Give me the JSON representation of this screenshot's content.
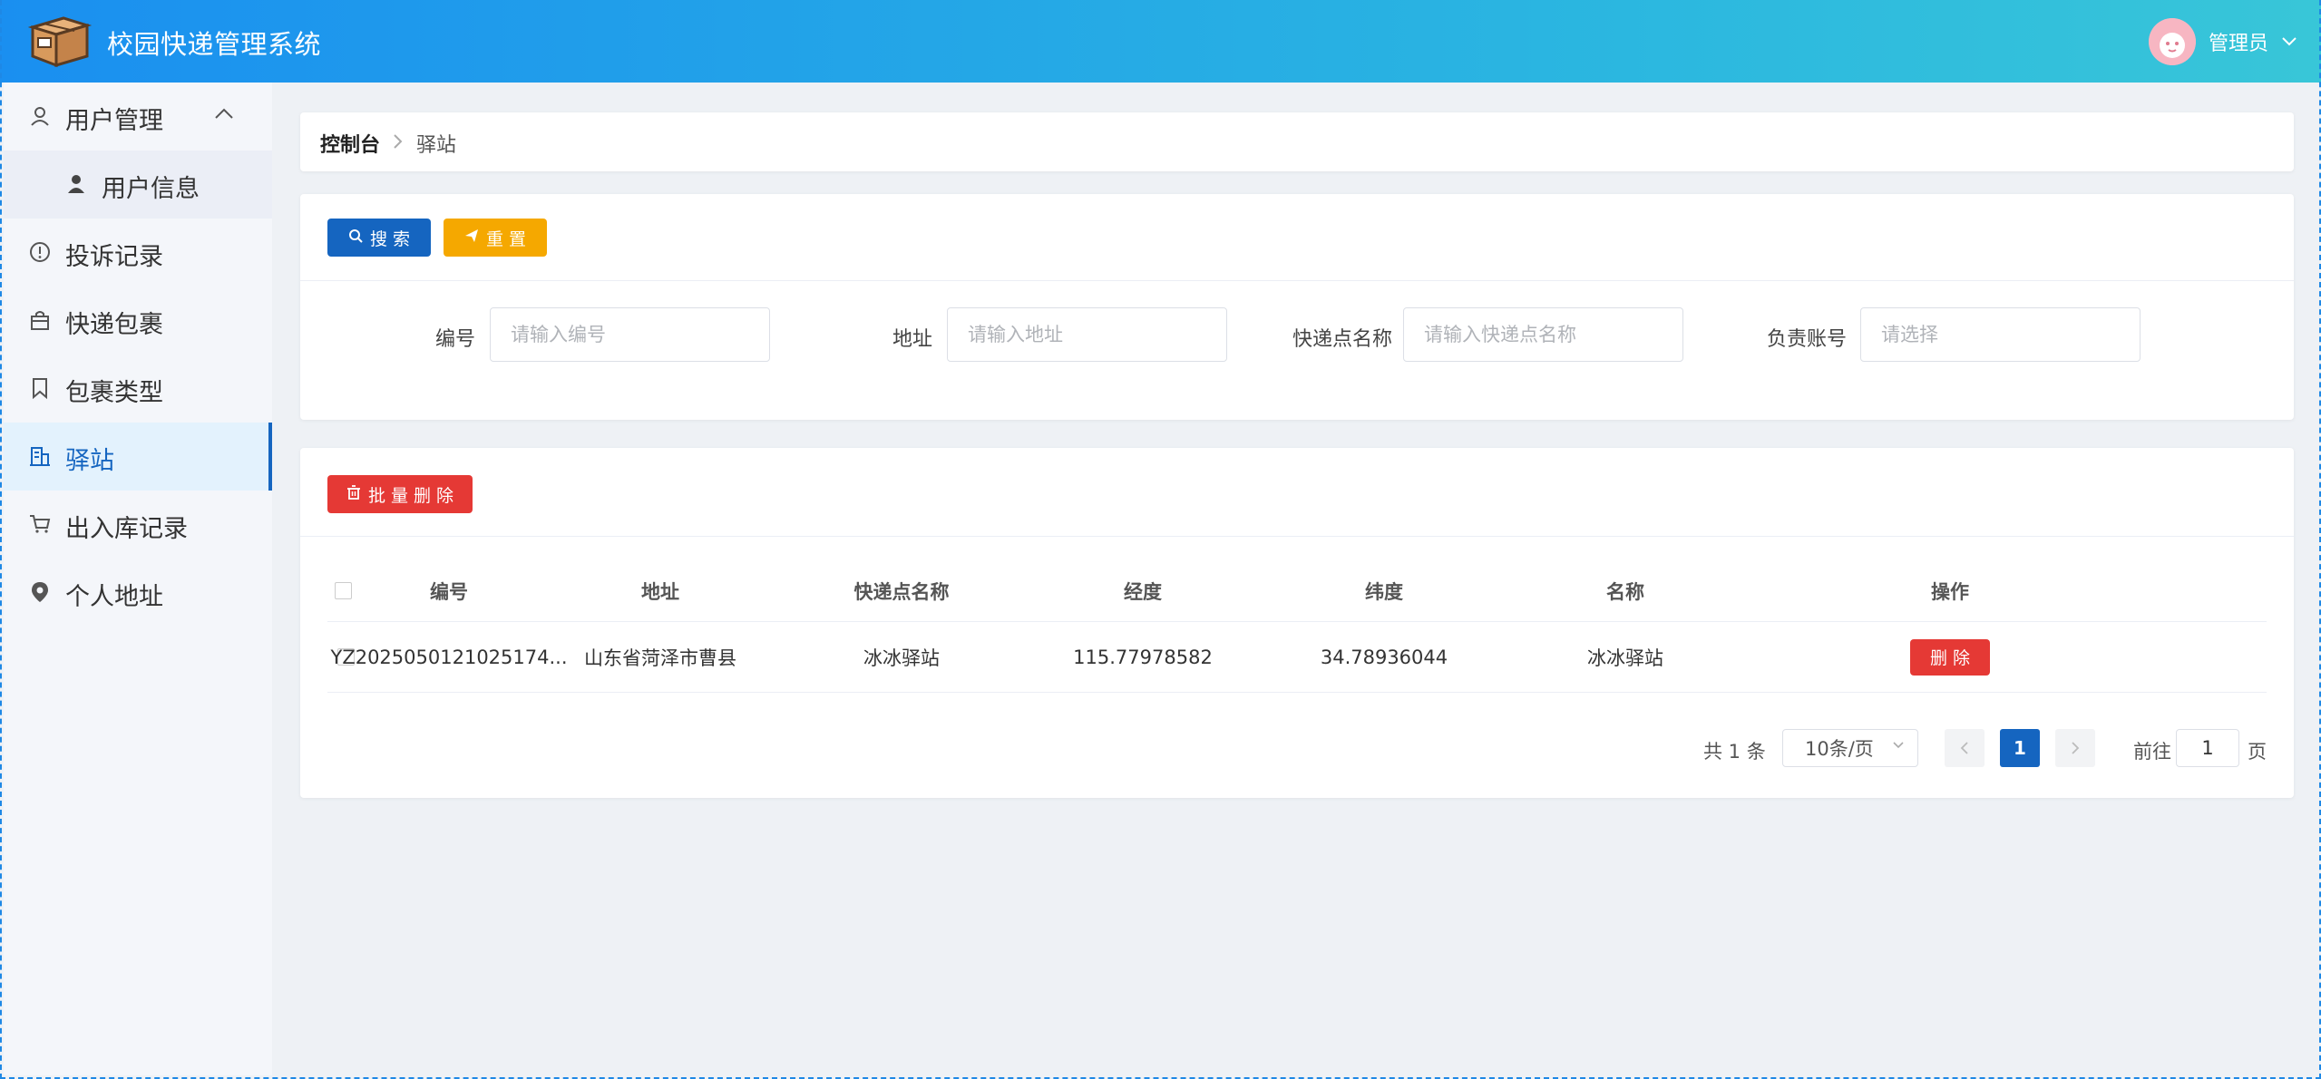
{
  "header": {
    "app_title": "校园快递管理系统",
    "user_name": "管理员"
  },
  "sidebar": {
    "items": [
      {
        "label": "用户管理",
        "icon": "user-outline-icon",
        "expanded": true
      },
      {
        "label": "用户信息",
        "icon": "user-filled-icon",
        "sub": true
      },
      {
        "label": "投诉记录",
        "icon": "warning-circle-icon"
      },
      {
        "label": "快递包裹",
        "icon": "shopping-bag-icon"
      },
      {
        "label": "包裹类型",
        "icon": "bookmark-icon"
      },
      {
        "label": "驿站",
        "icon": "office-building-icon",
        "active": true
      },
      {
        "label": "出入库记录",
        "icon": "shopping-cart-icon"
      },
      {
        "label": "个人地址",
        "icon": "location-pin-icon"
      }
    ]
  },
  "breadcrumb": {
    "home": "控制台",
    "current": "驿站"
  },
  "search": {
    "search_button": "搜 索",
    "reset_button": "重 置",
    "fields": [
      {
        "label": "编号",
        "placeholder": "请输入编号"
      },
      {
        "label": "地址",
        "placeholder": "请输入地址"
      },
      {
        "label": "快递点名称",
        "placeholder": "请输入快递点名称"
      },
      {
        "label": "负责账号",
        "placeholder": "请选择"
      }
    ]
  },
  "table": {
    "batch_delete_button": "批 量 删 除",
    "columns": [
      "编号",
      "地址",
      "快递点名称",
      "经度",
      "纬度",
      "名称",
      "操作"
    ],
    "rows": [
      {
        "id": "YZ2025050121025174...",
        "address": "山东省菏泽市曹县",
        "station_name": "冰冰驿站",
        "longitude": "115.77978582",
        "latitude": "34.78936044",
        "name": "冰冰驿站",
        "action": "删 除"
      }
    ]
  },
  "pagination": {
    "total": "共 1 条",
    "page_size": "10条/页",
    "current_page": "1",
    "goto_label": "前往",
    "goto_value": "1",
    "goto_suffix": "页"
  },
  "colors": {
    "header_gradient_start": "#1a8ff0",
    "header_gradient_end": "#38c6d8",
    "primary": "#1565c0",
    "warning": "#f5a800",
    "danger": "#e53935",
    "sidebar_bg": "#f4f6fa",
    "active_item_bg": "#e3f2fd"
  }
}
